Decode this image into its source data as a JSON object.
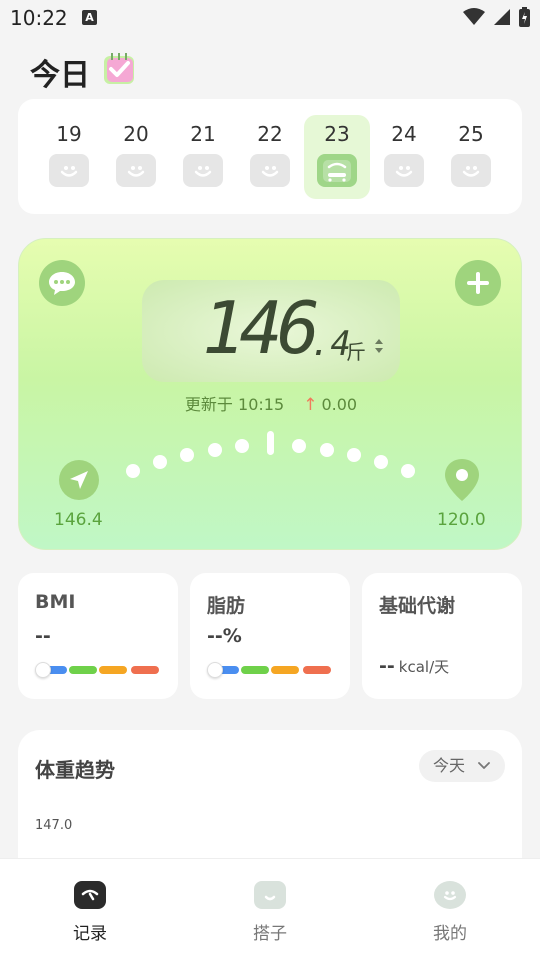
{
  "status_bar": {
    "time": "10:22",
    "notification_letter": "A"
  },
  "header": {
    "title": "今日"
  },
  "dates": [
    {
      "day": "19",
      "selected": false
    },
    {
      "day": "20",
      "selected": false
    },
    {
      "day": "21",
      "selected": false
    },
    {
      "day": "22",
      "selected": false
    },
    {
      "day": "23",
      "selected": true
    },
    {
      "day": "24",
      "selected": false
    },
    {
      "day": "25",
      "selected": false
    }
  ],
  "weight": {
    "value_int": "146",
    "value_dec": ".4",
    "unit": "斤",
    "updated_prefix": "更新于",
    "updated_time": "10:15",
    "delta": "0.00",
    "start_value": "146.4",
    "target_value": "120.0"
  },
  "metrics": {
    "bmi": {
      "title": "BMI",
      "value": "--"
    },
    "fat": {
      "title": "脂肪",
      "value": "--%"
    },
    "bmr": {
      "title": "基础代谢",
      "value": "--",
      "unit": "kcal/天"
    }
  },
  "trend": {
    "title": "体重趋势",
    "range_label": "今天",
    "tick_label": "147.0"
  },
  "nav": {
    "record": "记录",
    "partner": "搭子",
    "mine": "我的"
  },
  "colors": {
    "accent_green": "#9fd47d",
    "bar_blue": "#4a8ef0",
    "bar_green": "#6fd14a",
    "bar_orange": "#f5a623",
    "bar_red": "#ef6f4f"
  }
}
